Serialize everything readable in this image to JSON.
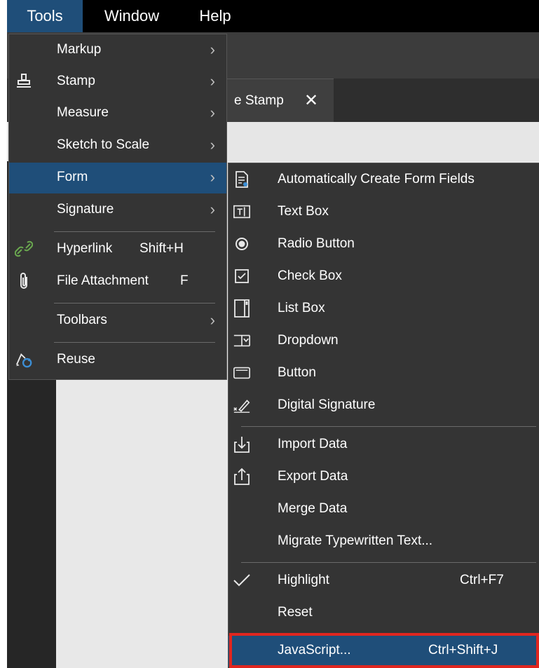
{
  "menubar": {
    "items": [
      {
        "label": "Tools"
      },
      {
        "label": "Window"
      },
      {
        "label": "Help"
      }
    ]
  },
  "tab": {
    "label": "e Stamp",
    "close": "✕"
  },
  "tools_menu": {
    "items": [
      {
        "label": "Markup",
        "icon": "none",
        "arrow": "›"
      },
      {
        "label": "Stamp",
        "icon": "stamp-icon",
        "arrow": "›"
      },
      {
        "label": "Measure",
        "icon": "none",
        "arrow": "›"
      },
      {
        "label": "Sketch to Scale",
        "icon": "none",
        "arrow": "›"
      },
      {
        "label": "Form",
        "icon": "none",
        "arrow": "›",
        "highlighted": true
      },
      {
        "label": "Signature",
        "icon": "none",
        "arrow": "›"
      },
      {
        "label": "Hyperlink",
        "shortcut": "Shift+H",
        "icon": "link-icon"
      },
      {
        "label": "File Attachment",
        "shortcut": "F",
        "icon": "paperclip-icon"
      },
      {
        "label": "Toolbars",
        "icon": "none",
        "arrow": "›"
      },
      {
        "label": "Reuse",
        "icon": "reuse-icon"
      }
    ]
  },
  "form_menu": {
    "items": [
      {
        "label": "Automatically Create Form Fields",
        "icon": "auto-form-icon"
      },
      {
        "label": "Text Box",
        "icon": "textbox-icon"
      },
      {
        "label": "Radio Button",
        "icon": "radio-icon"
      },
      {
        "label": "Check Box",
        "icon": "checkbox-icon"
      },
      {
        "label": "List Box",
        "icon": "listbox-icon"
      },
      {
        "label": "Dropdown",
        "icon": "dropdown-icon"
      },
      {
        "label": "Button",
        "icon": "button-icon"
      },
      {
        "label": "Digital Signature",
        "icon": "signature-icon"
      },
      {
        "label": "Import Data",
        "icon": "import-icon"
      },
      {
        "label": "Export Data",
        "icon": "export-icon"
      },
      {
        "label": "Merge Data"
      },
      {
        "label": "Migrate Typewritten Text..."
      },
      {
        "label": "Highlight",
        "shortcut": "Ctrl+F7",
        "checked": true
      },
      {
        "label": "Reset"
      },
      {
        "label": "JavaScript...",
        "shortcut": "Ctrl+Shift+J",
        "highlighted": true
      }
    ]
  },
  "colors": {
    "menu_bg": "#343434",
    "highlight": "#1f4e79",
    "callout": "#e0261f",
    "link_icon": "#6aa84f",
    "reuse_icon": "#3c8fd6"
  }
}
